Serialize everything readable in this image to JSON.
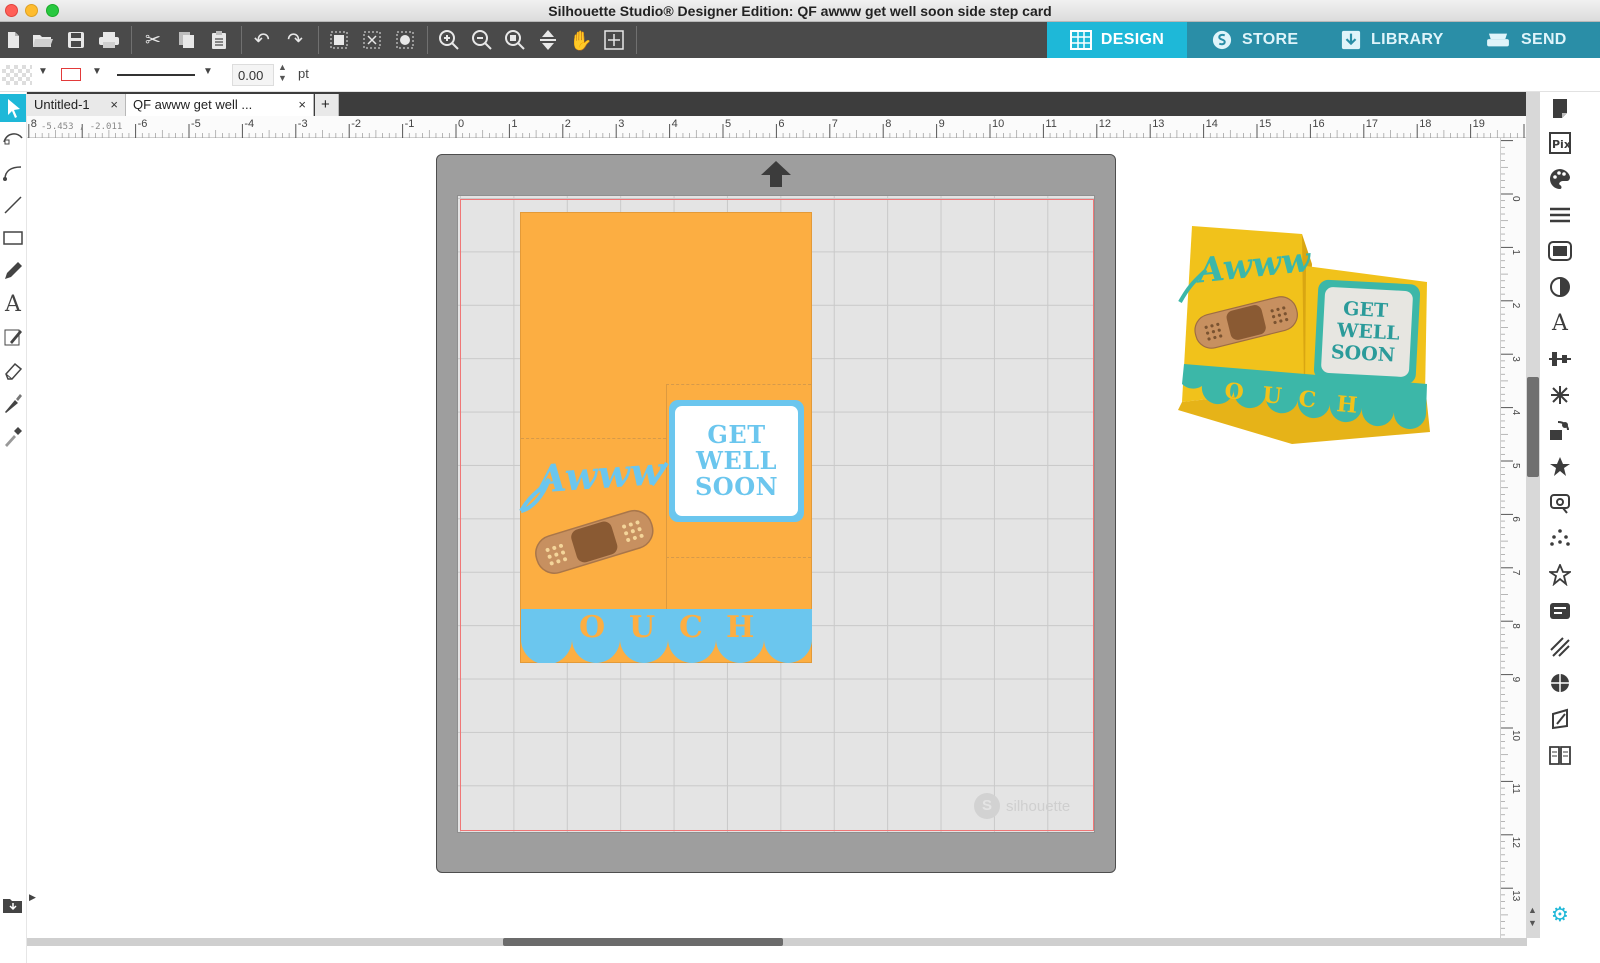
{
  "window": {
    "title": "Silhouette Studio® Designer Edition: QF awww get well soon side step card"
  },
  "toolbar": {
    "icons": [
      "new-document-icon",
      "open-icon",
      "save-icon",
      "print-icon",
      "cut-icon",
      "copy-icon",
      "paste-icon",
      "undo-icon",
      "redo-icon",
      "group-icon",
      "ungroup-icon",
      "release-compound-icon",
      "zoom-in-icon",
      "zoom-out-icon",
      "zoom-selection-icon",
      "drag-zoom-icon",
      "pan-icon",
      "fit-to-page-icon"
    ],
    "modes": [
      {
        "label": "DESIGN",
        "icon": "grid-icon",
        "active": true
      },
      {
        "label": "STORE",
        "icon": "silhouette-s-icon",
        "active": false
      },
      {
        "label": "LIBRARY",
        "icon": "download-library-icon",
        "active": false
      },
      {
        "label": "SEND",
        "icon": "cutter-icon",
        "active": false
      }
    ]
  },
  "properties": {
    "line_width": "0.00",
    "line_unit": "pt",
    "line_color": "#e23a3a"
  },
  "tabs": [
    {
      "label": "Untitled-1",
      "active": false,
      "close": "×"
    },
    {
      "label": "QF awww get well ...",
      "active": true,
      "close": "×"
    }
  ],
  "add_tab": "+",
  "ruler": {
    "coord_readout": "-5.453 , -2.011",
    "top_ticks": [
      "8",
      "-6",
      "-5",
      "-4",
      "-3",
      "-2",
      "-1",
      "0",
      "1",
      "2",
      "3",
      "4",
      "5",
      "6",
      "7",
      "8",
      "9",
      "10",
      "11",
      "12",
      "13",
      "14",
      "15",
      "16",
      "17",
      "18",
      "19"
    ],
    "right_ticks": [
      "-1",
      "0",
      "1",
      "2",
      "3",
      "4",
      "5",
      "6",
      "7",
      "8",
      "9",
      "10",
      "11",
      "12",
      "13"
    ]
  },
  "mat": {
    "watermark": "silhouette"
  },
  "design": {
    "awww_text": "Awww",
    "get_well_soon": [
      "GET",
      "WELL",
      "SOON"
    ],
    "ouch_letters": [
      "O",
      "U",
      "C",
      "H"
    ]
  },
  "preview": {
    "awww_text": "Awww",
    "get_well_soon": [
      "GET",
      "WELL",
      "SOON"
    ],
    "ouch_letters": [
      "O",
      "U",
      "C",
      "H"
    ]
  },
  "colors": {
    "accent": "#1eb8d8",
    "card_orange": "#fcae42",
    "design_blue": "#6bc6ee",
    "bandage_brown": "#c79060",
    "preview_yellow": "#f1c21b",
    "preview_teal": "#3cb7a8"
  }
}
